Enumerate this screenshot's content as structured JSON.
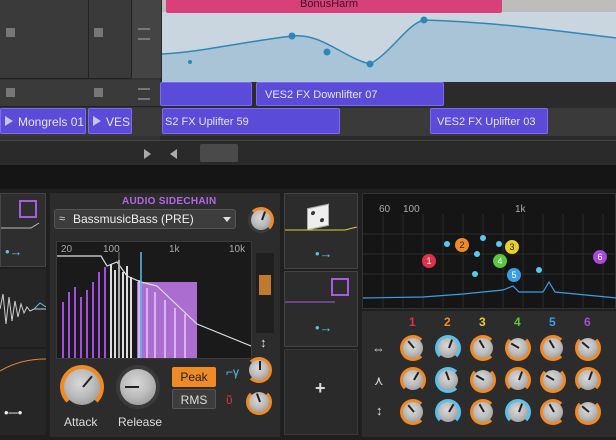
{
  "arranger": {
    "clips": {
      "bonus_harm": "BonusHarm",
      "downlifter": "VES2 FX Downlifter 07",
      "uplifter_59": "S2 FX Uplifter 59",
      "uplifter_03": "VES2 FX Uplifter 03",
      "mongrels": "Mongrels 01",
      "ves_partial": "VES"
    }
  },
  "sidechain": {
    "title": "AUDIO SIDECHAIN",
    "source": "BassmusicBass (PRE)",
    "freq_labels": [
      "20",
      "100",
      "1k",
      "10k"
    ],
    "attack_label": "Attack",
    "release_label": "Release",
    "peak_label": "Peak",
    "rms_label": "RMS"
  },
  "eq": {
    "freq_labels": [
      "60",
      "100",
      "1k"
    ],
    "bands": [
      {
        "num": "1",
        "color": "#e0304a"
      },
      {
        "num": "2",
        "color": "#f08a24"
      },
      {
        "num": "3",
        "color": "#e6d02a"
      },
      {
        "num": "4",
        "color": "#5ac83c"
      },
      {
        "num": "5",
        "color": "#3a9ee6"
      },
      {
        "num": "6",
        "color": "#a64ad8"
      }
    ],
    "row_icons": [
      "link-icon",
      "shape-icon",
      "updown-icon"
    ]
  },
  "add_symbol": "+"
}
